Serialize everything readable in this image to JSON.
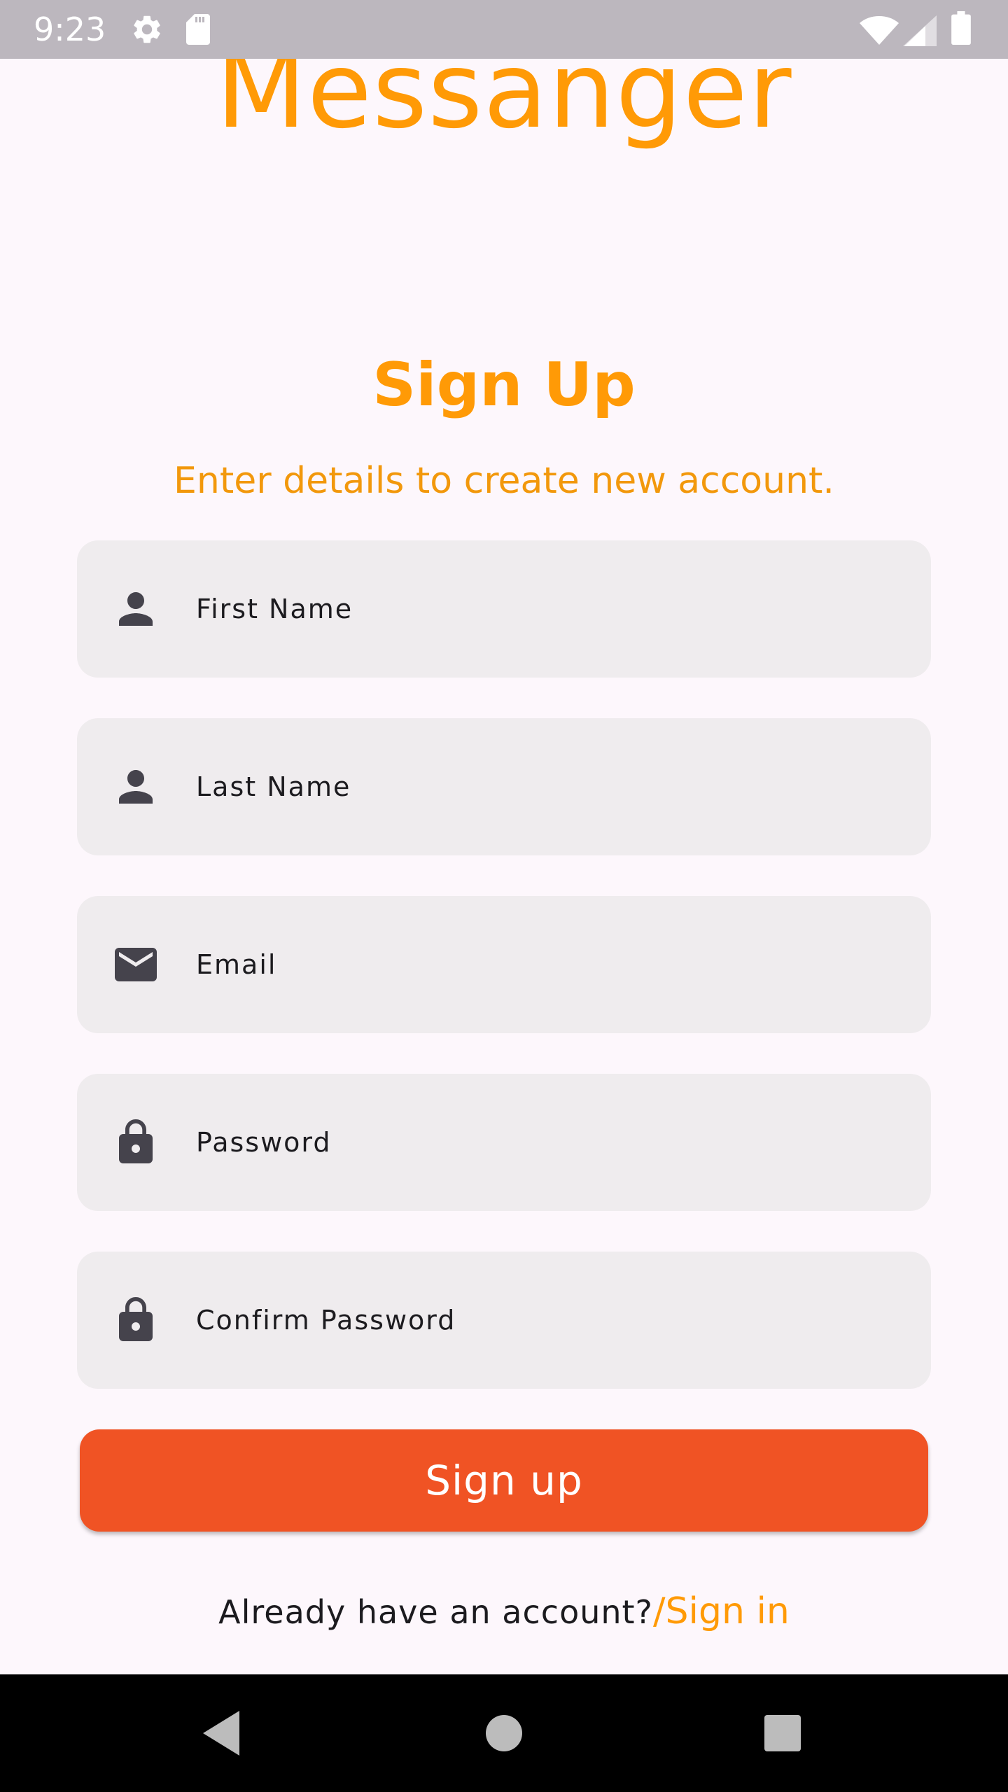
{
  "status_bar": {
    "time": "9:23",
    "icons": [
      "settings-icon",
      "sd-card-icon",
      "wifi-icon",
      "cell-signal-icon",
      "battery-icon"
    ]
  },
  "app": {
    "title": "Messanger"
  },
  "form": {
    "heading": "Sign Up",
    "subheading": "Enter details to create new account.",
    "fields": [
      {
        "placeholder": "First Name",
        "value": "",
        "icon": "person-icon"
      },
      {
        "placeholder": "Last Name",
        "value": "",
        "icon": "person-icon"
      },
      {
        "placeholder": "Email",
        "value": "",
        "icon": "mail-icon"
      },
      {
        "placeholder": "Password",
        "value": "",
        "icon": "lock-icon"
      },
      {
        "placeholder": "Confirm Password",
        "value": "",
        "icon": "lock-icon"
      }
    ],
    "submit_label": "Sign up",
    "signin_prompt": "Already have an account?",
    "signin_link": "/Sign in"
  },
  "nav_bar": {
    "buttons": [
      "back-icon",
      "home-icon",
      "recents-icon"
    ]
  },
  "colors": {
    "accent": "#ff9a06",
    "button": "#f05324",
    "background": "#fdf7fc",
    "field": "#efecee",
    "icon": "#45434c"
  }
}
